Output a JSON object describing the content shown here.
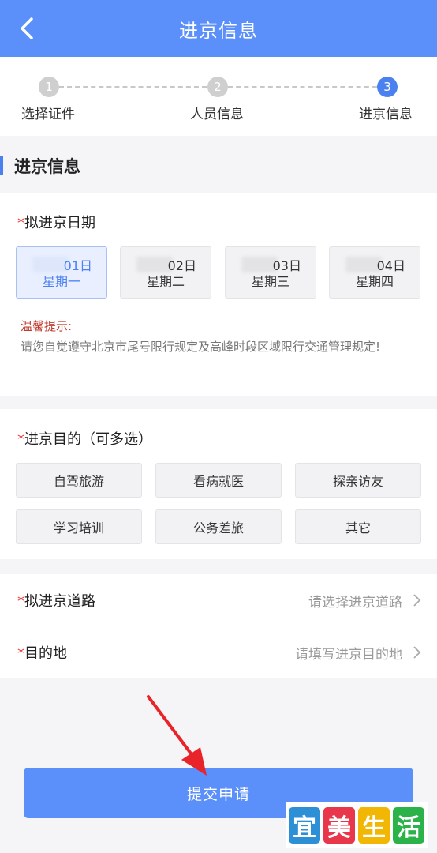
{
  "header": {
    "title": "进京信息",
    "back_icon": "chevron-left-icon"
  },
  "stepper": {
    "steps": [
      {
        "number": "1",
        "label": "选择证件",
        "state": "done"
      },
      {
        "number": "2",
        "label": "人员信息",
        "state": "done"
      },
      {
        "number": "3",
        "label": "进京信息",
        "state": "current"
      }
    ]
  },
  "section": {
    "title": "进京信息"
  },
  "date_field": {
    "required_mark": "*",
    "label": "拟进京日期",
    "options": [
      {
        "day": "01日",
        "week": "星期一",
        "selected": true
      },
      {
        "day": "02日",
        "week": "星期二",
        "selected": false
      },
      {
        "day": "03日",
        "week": "星期三",
        "selected": false
      },
      {
        "day": "04日",
        "week": "星期四",
        "selected": false
      }
    ]
  },
  "tip": {
    "title": "温馨提示:",
    "text": "请您自觉遵守北京市尾号限行规定及高峰时段区域限行交通管理规定!"
  },
  "purpose_field": {
    "required_mark": "*",
    "label": "进京目的（可多选）",
    "options": [
      "自驾旅游",
      "看病就医",
      "探亲访友",
      "学习培训",
      "公务差旅",
      "其它"
    ]
  },
  "road_field": {
    "required_mark": "*",
    "label": "拟进京道路",
    "placeholder": "请选择进京道路"
  },
  "destination_field": {
    "required_mark": "*",
    "label": "目的地",
    "placeholder": "请填写进京目的地"
  },
  "submit": {
    "label": "提交申请"
  },
  "watermark": {
    "chars": [
      "宜",
      "美",
      "生",
      "活"
    ],
    "colors": [
      "#2d8fd5",
      "#e8364a",
      "#f2b705",
      "#2bb34a"
    ]
  },
  "colors": {
    "accent": "#5b8ff9",
    "step_active": "#4a80f0",
    "tip_red": "#c0392b"
  }
}
